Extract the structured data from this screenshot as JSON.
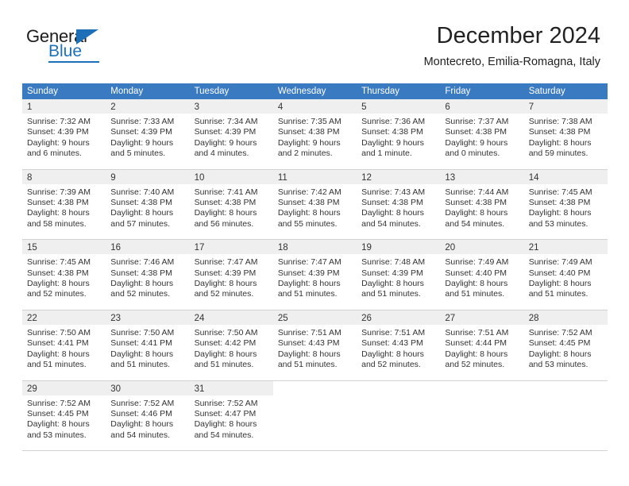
{
  "brand": {
    "name_top": "General",
    "name_bottom": "Blue",
    "accent_color": "#1d70b7"
  },
  "header": {
    "title": "December 2024",
    "subtitle": "Montecreto, Emilia-Romagna, Italy"
  },
  "calendar": {
    "header_color": "#3a7ac0",
    "daynum_bg": "#efefef",
    "weekdays": [
      "Sunday",
      "Monday",
      "Tuesday",
      "Wednesday",
      "Thursday",
      "Friday",
      "Saturday"
    ],
    "weeks": [
      [
        {
          "day": "1",
          "sunrise": "Sunrise: 7:32 AM",
          "sunset": "Sunset: 4:39 PM",
          "daylight_line1": "Daylight: 9 hours",
          "daylight_line2": "and 6 minutes."
        },
        {
          "day": "2",
          "sunrise": "Sunrise: 7:33 AM",
          "sunset": "Sunset: 4:39 PM",
          "daylight_line1": "Daylight: 9 hours",
          "daylight_line2": "and 5 minutes."
        },
        {
          "day": "3",
          "sunrise": "Sunrise: 7:34 AM",
          "sunset": "Sunset: 4:39 PM",
          "daylight_line1": "Daylight: 9 hours",
          "daylight_line2": "and 4 minutes."
        },
        {
          "day": "4",
          "sunrise": "Sunrise: 7:35 AM",
          "sunset": "Sunset: 4:38 PM",
          "daylight_line1": "Daylight: 9 hours",
          "daylight_line2": "and 2 minutes."
        },
        {
          "day": "5",
          "sunrise": "Sunrise: 7:36 AM",
          "sunset": "Sunset: 4:38 PM",
          "daylight_line1": "Daylight: 9 hours",
          "daylight_line2": "and 1 minute."
        },
        {
          "day": "6",
          "sunrise": "Sunrise: 7:37 AM",
          "sunset": "Sunset: 4:38 PM",
          "daylight_line1": "Daylight: 9 hours",
          "daylight_line2": "and 0 minutes."
        },
        {
          "day": "7",
          "sunrise": "Sunrise: 7:38 AM",
          "sunset": "Sunset: 4:38 PM",
          "daylight_line1": "Daylight: 8 hours",
          "daylight_line2": "and 59 minutes."
        }
      ],
      [
        {
          "day": "8",
          "sunrise": "Sunrise: 7:39 AM",
          "sunset": "Sunset: 4:38 PM",
          "daylight_line1": "Daylight: 8 hours",
          "daylight_line2": "and 58 minutes."
        },
        {
          "day": "9",
          "sunrise": "Sunrise: 7:40 AM",
          "sunset": "Sunset: 4:38 PM",
          "daylight_line1": "Daylight: 8 hours",
          "daylight_line2": "and 57 minutes."
        },
        {
          "day": "10",
          "sunrise": "Sunrise: 7:41 AM",
          "sunset": "Sunset: 4:38 PM",
          "daylight_line1": "Daylight: 8 hours",
          "daylight_line2": "and 56 minutes."
        },
        {
          "day": "11",
          "sunrise": "Sunrise: 7:42 AM",
          "sunset": "Sunset: 4:38 PM",
          "daylight_line1": "Daylight: 8 hours",
          "daylight_line2": "and 55 minutes."
        },
        {
          "day": "12",
          "sunrise": "Sunrise: 7:43 AM",
          "sunset": "Sunset: 4:38 PM",
          "daylight_line1": "Daylight: 8 hours",
          "daylight_line2": "and 54 minutes."
        },
        {
          "day": "13",
          "sunrise": "Sunrise: 7:44 AM",
          "sunset": "Sunset: 4:38 PM",
          "daylight_line1": "Daylight: 8 hours",
          "daylight_line2": "and 54 minutes."
        },
        {
          "day": "14",
          "sunrise": "Sunrise: 7:45 AM",
          "sunset": "Sunset: 4:38 PM",
          "daylight_line1": "Daylight: 8 hours",
          "daylight_line2": "and 53 minutes."
        }
      ],
      [
        {
          "day": "15",
          "sunrise": "Sunrise: 7:45 AM",
          "sunset": "Sunset: 4:38 PM",
          "daylight_line1": "Daylight: 8 hours",
          "daylight_line2": "and 52 minutes."
        },
        {
          "day": "16",
          "sunrise": "Sunrise: 7:46 AM",
          "sunset": "Sunset: 4:38 PM",
          "daylight_line1": "Daylight: 8 hours",
          "daylight_line2": "and 52 minutes."
        },
        {
          "day": "17",
          "sunrise": "Sunrise: 7:47 AM",
          "sunset": "Sunset: 4:39 PM",
          "daylight_line1": "Daylight: 8 hours",
          "daylight_line2": "and 52 minutes."
        },
        {
          "day": "18",
          "sunrise": "Sunrise: 7:47 AM",
          "sunset": "Sunset: 4:39 PM",
          "daylight_line1": "Daylight: 8 hours",
          "daylight_line2": "and 51 minutes."
        },
        {
          "day": "19",
          "sunrise": "Sunrise: 7:48 AM",
          "sunset": "Sunset: 4:39 PM",
          "daylight_line1": "Daylight: 8 hours",
          "daylight_line2": "and 51 minutes."
        },
        {
          "day": "20",
          "sunrise": "Sunrise: 7:49 AM",
          "sunset": "Sunset: 4:40 PM",
          "daylight_line1": "Daylight: 8 hours",
          "daylight_line2": "and 51 minutes."
        },
        {
          "day": "21",
          "sunrise": "Sunrise: 7:49 AM",
          "sunset": "Sunset: 4:40 PM",
          "daylight_line1": "Daylight: 8 hours",
          "daylight_line2": "and 51 minutes."
        }
      ],
      [
        {
          "day": "22",
          "sunrise": "Sunrise: 7:50 AM",
          "sunset": "Sunset: 4:41 PM",
          "daylight_line1": "Daylight: 8 hours",
          "daylight_line2": "and 51 minutes."
        },
        {
          "day": "23",
          "sunrise": "Sunrise: 7:50 AM",
          "sunset": "Sunset: 4:41 PM",
          "daylight_line1": "Daylight: 8 hours",
          "daylight_line2": "and 51 minutes."
        },
        {
          "day": "24",
          "sunrise": "Sunrise: 7:50 AM",
          "sunset": "Sunset: 4:42 PM",
          "daylight_line1": "Daylight: 8 hours",
          "daylight_line2": "and 51 minutes."
        },
        {
          "day": "25",
          "sunrise": "Sunrise: 7:51 AM",
          "sunset": "Sunset: 4:43 PM",
          "daylight_line1": "Daylight: 8 hours",
          "daylight_line2": "and 51 minutes."
        },
        {
          "day": "26",
          "sunrise": "Sunrise: 7:51 AM",
          "sunset": "Sunset: 4:43 PM",
          "daylight_line1": "Daylight: 8 hours",
          "daylight_line2": "and 52 minutes."
        },
        {
          "day": "27",
          "sunrise": "Sunrise: 7:51 AM",
          "sunset": "Sunset: 4:44 PM",
          "daylight_line1": "Daylight: 8 hours",
          "daylight_line2": "and 52 minutes."
        },
        {
          "day": "28",
          "sunrise": "Sunrise: 7:52 AM",
          "sunset": "Sunset: 4:45 PM",
          "daylight_line1": "Daylight: 8 hours",
          "daylight_line2": "and 53 minutes."
        }
      ],
      [
        {
          "day": "29",
          "sunrise": "Sunrise: 7:52 AM",
          "sunset": "Sunset: 4:45 PM",
          "daylight_line1": "Daylight: 8 hours",
          "daylight_line2": "and 53 minutes."
        },
        {
          "day": "30",
          "sunrise": "Sunrise: 7:52 AM",
          "sunset": "Sunset: 4:46 PM",
          "daylight_line1": "Daylight: 8 hours",
          "daylight_line2": "and 54 minutes."
        },
        {
          "day": "31",
          "sunrise": "Sunrise: 7:52 AM",
          "sunset": "Sunset: 4:47 PM",
          "daylight_line1": "Daylight: 8 hours",
          "daylight_line2": "and 54 minutes."
        },
        {
          "day": "",
          "sunrise": "",
          "sunset": "",
          "daylight_line1": "",
          "daylight_line2": ""
        },
        {
          "day": "",
          "sunrise": "",
          "sunset": "",
          "daylight_line1": "",
          "daylight_line2": ""
        },
        {
          "day": "",
          "sunrise": "",
          "sunset": "",
          "daylight_line1": "",
          "daylight_line2": ""
        },
        {
          "day": "",
          "sunrise": "",
          "sunset": "",
          "daylight_line1": "",
          "daylight_line2": ""
        }
      ]
    ]
  }
}
